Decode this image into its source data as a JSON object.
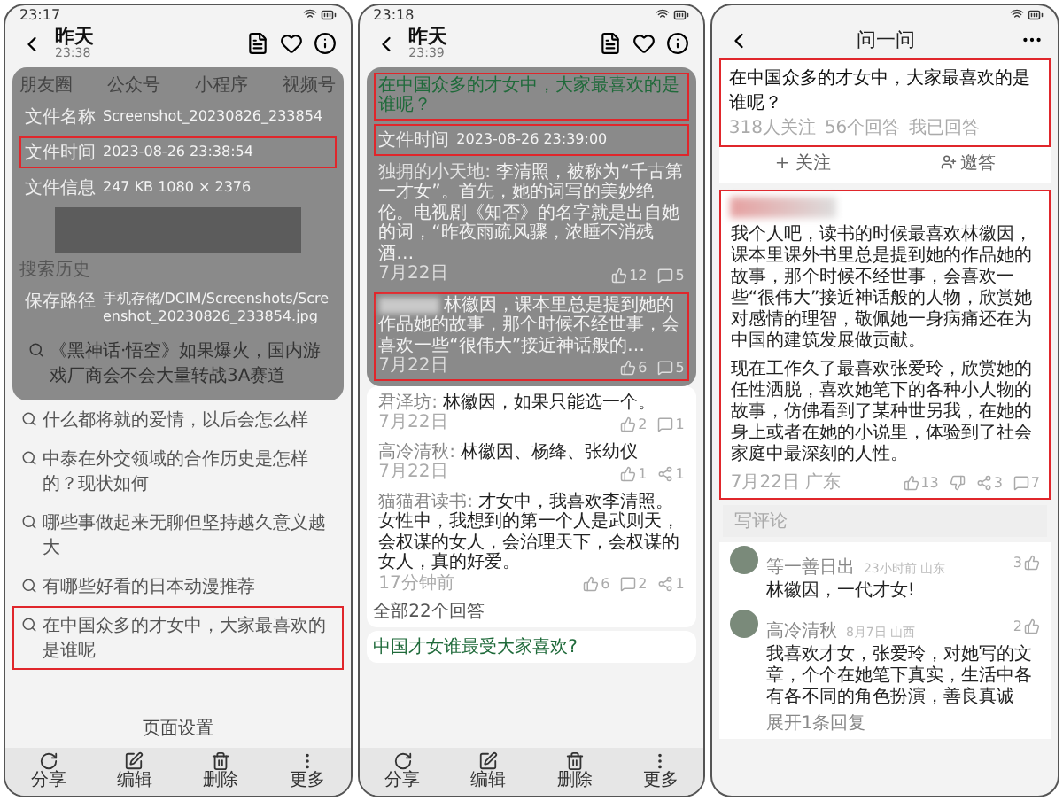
{
  "panels": [
    {
      "kind": "history",
      "status_time": "23:17",
      "header": {
        "title": "昨天",
        "subtitle": "23:38"
      },
      "overlay": {
        "tabs": [
          "朋友圈",
          "公众号",
          "小程序",
          "视频号"
        ],
        "file_info": [
          {
            "label": "文件名称",
            "value": "Screenshot_20230826_233854",
            "highlighted": false
          },
          {
            "label": "文件时间",
            "value": "2023-08-26 23:38:54",
            "highlighted": true
          },
          {
            "label": "文件信息",
            "value": "247 KB  1080 × 2376",
            "highlighted": false
          }
        ],
        "history_label": "搜索历史",
        "save_path": {
          "label": "保存路径",
          "value": "手机存储/DCIM/Screenshots/Screenshot_20230826_233854.jpg"
        },
        "history_item": "《黑神话·悟空》如果爆火，国内游戏厂商会不会大量转战3A赛道"
      },
      "history": [
        {
          "text": "什么都将就的爱情，以后会怎么样",
          "highlighted": false
        },
        {
          "text": "中泰在外交领域的合作历史是怎样的？现状如何",
          "highlighted": false
        },
        {
          "text": "哪些事做起来无聊但坚持越久意义越大",
          "highlighted": false
        },
        {
          "text": "有哪些好看的日本动漫推荐",
          "highlighted": false
        },
        {
          "text": "在中国众多的才女中，大家最喜欢的是谁呢",
          "highlighted": true
        }
      ],
      "footer_link": "页面设置",
      "toolbar": [
        {
          "kind": "share",
          "label": "分享"
        },
        {
          "kind": "edit",
          "label": "编辑"
        },
        {
          "kind": "delete",
          "label": "删除"
        },
        {
          "kind": "more",
          "label": "更多"
        }
      ]
    },
    {
      "kind": "answers",
      "status_time": "23:18",
      "header": {
        "title": "昨天",
        "subtitle": "23:39"
      },
      "overlay": {
        "question": {
          "text": "在中国众多的才女中，大家最喜欢的是谁呢？",
          "highlighted": true
        },
        "file_time": {
          "label": "文件时间",
          "value": "2023-08-26 23:39:00",
          "highlighted": true
        },
        "answers": [
          {
            "author": "独拥的小天地:",
            "blurred_author": false,
            "text": "李清照，被称为“千古第一才女”。首先，她的词写的美妙绝伦。电视剧《知否》的名字就是出自她的词，“昨夜雨疏风骤，浓睡不消残酒…",
            "date": "7月22日",
            "highlighted": false,
            "stats": [
              {
                "kind": "like",
                "count": "12"
              },
              {
                "kind": "comment",
                "count": "5"
              }
            ]
          },
          {
            "blurred_author": true,
            "text": "林徽因，课本里总是提到她的作品她的故事，那个时候不经世事，会喜欢一些“很伟大”接近神话般的…",
            "date": "7月22日",
            "highlighted": true,
            "stats": [
              {
                "kind": "like",
                "count": "6"
              },
              {
                "kind": "comment",
                "count": "5"
              }
            ]
          }
        ]
      },
      "answers": [
        {
          "author": "君泽坊:",
          "blurred_author": false,
          "text": "林徽因，如果只能选一个。",
          "date": "7月22日",
          "highlighted": false,
          "stats": [
            {
              "kind": "like",
              "count": "2"
            },
            {
              "kind": "comment",
              "count": "1"
            }
          ]
        },
        {
          "author": "高冷清秋:",
          "blurred_author": false,
          "text": "林徽因、杨绛、张幼仪",
          "date": "7月22日",
          "highlighted": false,
          "stats": [
            {
              "kind": "like",
              "count": "1"
            },
            {
              "kind": "share",
              "count": "1"
            }
          ]
        },
        {
          "author": "猫猫君读书:",
          "blurred_author": false,
          "text": "才女中，我喜欢李清照。女性中，我想到的第一个人是武则天，会权谋的女人，会治理天下，会权谋的女人，真的好爱。",
          "date": "17分钟前",
          "highlighted": false,
          "stats": [
            {
              "kind": "like",
              "count": "6"
            },
            {
              "kind": "comment",
              "count": "2"
            },
            {
              "kind": "share",
              "count": "1"
            }
          ]
        }
      ],
      "all_answers": "全部22个回答",
      "next_question": "中国才女谁最受大家喜欢?",
      "toolbar": [
        {
          "kind": "share",
          "label": "分享"
        },
        {
          "kind": "edit",
          "label": "编辑"
        },
        {
          "kind": "delete",
          "label": "删除"
        },
        {
          "kind": "more",
          "label": "更多"
        }
      ]
    },
    {
      "kind": "detail",
      "header": {
        "title": "问一问"
      },
      "question": {
        "text": "在中国众多的才女中，大家最喜欢的是谁呢？",
        "meta": [
          "318人关注",
          "56个回答",
          "我已回答"
        ],
        "highlighted": true
      },
      "actions": [
        {
          "kind": "follow",
          "label": "+ 关注"
        },
        {
          "kind": "invite",
          "label": "邀答"
        }
      ],
      "answer": {
        "highlighted": true,
        "paragraphs": [
          "我个人吧，读书的时候最喜欢林徽因，课本里课外书里总是提到她的作品她的故事，那个时候不经世事，会喜欢一些“很伟大”接近神话般的人物，欣赏她对感情的理智，敬佩她一身病痛还在为中国的建筑发展做贡献。",
          "现在工作久了最喜欢张爱玲，欣赏她的任性洒脱，喜欢她笔下的各种小人物的故事，仿佛看到了某种世另我，在她的身上或者在她的小说里，体验到了社会家庭中最深刻的人性。"
        ],
        "date": "7月22日",
        "location": "广东",
        "stats": [
          {
            "kind": "like",
            "count": "13"
          },
          {
            "kind": "dislike"
          },
          {
            "kind": "share",
            "count": "3"
          },
          {
            "kind": "comment",
            "count": "7"
          }
        ]
      },
      "comment_placeholder": "写评论",
      "comments": [
        {
          "author": "等一善日出",
          "time": "23小时前",
          "location": "山东",
          "likes": "3",
          "text": "林徽因，一代才女!"
        },
        {
          "author": "高冷清秋",
          "time": "8月7日",
          "location": "山西",
          "likes": "2",
          "text": "我喜欢才女，张爱玲，对她写的文章，个个在她笔下真实，生活中各有各不同的角色扮演，善良真诚",
          "replies": "展开1条回复"
        }
      ]
    }
  ]
}
